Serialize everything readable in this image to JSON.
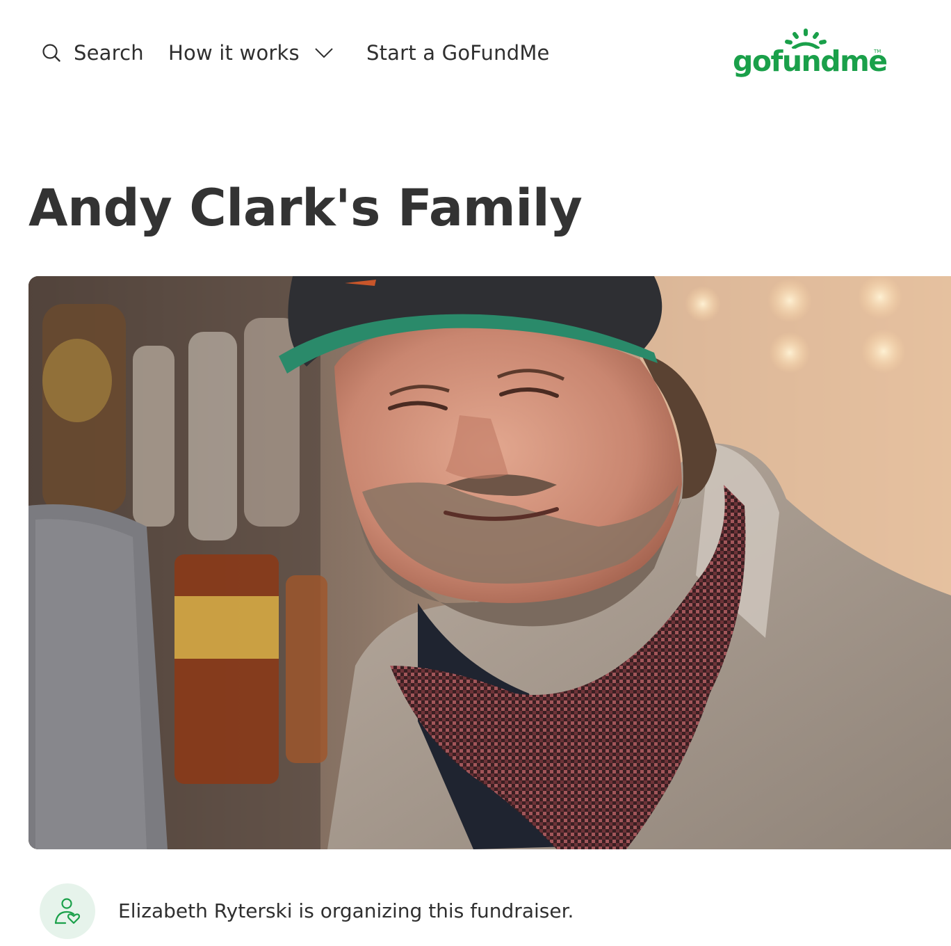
{
  "header": {
    "nav": {
      "search_label": "Search",
      "how_it_works_label": "How it works",
      "start_label": "Start a GoFundMe"
    },
    "logo": {
      "text": "gofundme",
      "trademark": "TM",
      "color": "#1aa04a"
    }
  },
  "campaign": {
    "title": "Andy Clark's Family",
    "hero_image_alt": "Andy Clark",
    "organizer_text": "Elizabeth Ryterski is organizing this fundraiser."
  },
  "icons": {
    "search": "search-icon",
    "chevron": "chevron-down-icon",
    "organizer": "organizer-heart-icon",
    "logo_sun": "sun-rays-icon"
  },
  "colors": {
    "brand_green": "#1aa04a",
    "avatar_bg": "#e6f3eb",
    "text": "#333333"
  }
}
